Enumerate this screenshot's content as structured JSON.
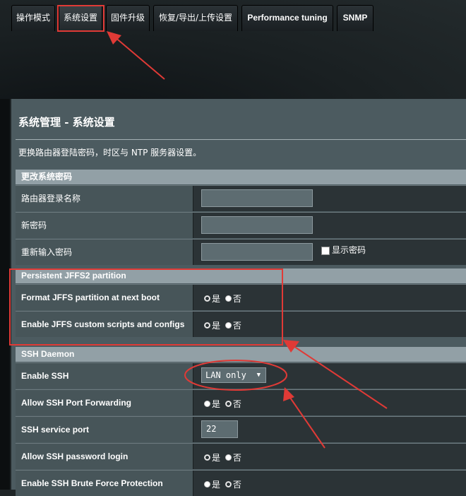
{
  "tabs": [
    {
      "label": "操作模式"
    },
    {
      "label": "系统设置"
    },
    {
      "label": "固件升级"
    },
    {
      "label": "恢复/导出/上传设置"
    },
    {
      "label": "Performance tuning"
    },
    {
      "label": "SNMP"
    }
  ],
  "panel": {
    "title": "系统管理 - 系统设置",
    "description": "更换路由器登陆密码，时区与 NTP 服务器设置。"
  },
  "sections": {
    "password": {
      "heading": "更改系统密码",
      "router_login_name": {
        "label": "路由器登录名称",
        "value": ""
      },
      "new_password": {
        "label": "新密码",
        "value": ""
      },
      "reenter_password": {
        "label": "重新输入密码",
        "value": "",
        "show_password_label": "显示密码"
      }
    },
    "jffs": {
      "heading": "Persistent JFFS2 partition",
      "format_jffs": {
        "label": "Format JFFS partition at next boot",
        "yes": "是",
        "no": "否",
        "selected": "yes"
      },
      "custom_scripts": {
        "label": "Enable JFFS custom scripts and configs",
        "yes": "是",
        "no": "否",
        "selected": "yes"
      }
    },
    "ssh": {
      "heading": "SSH Daemon",
      "enable_ssh": {
        "label": "Enable SSH",
        "value": "LAN only"
      },
      "port_forwarding": {
        "label": "Allow SSH Port Forwarding",
        "yes": "是",
        "no": "否",
        "selected": "no"
      },
      "service_port": {
        "label": "SSH service port",
        "value": "22"
      },
      "password_login": {
        "label": "Allow SSH password login",
        "yes": "是",
        "no": "否",
        "selected": "yes"
      },
      "brute_force": {
        "label": "Enable SSH Brute Force Protection",
        "yes": "是",
        "no": "否",
        "selected": "no"
      }
    }
  },
  "colors": {
    "annotation": "#e03a36"
  }
}
